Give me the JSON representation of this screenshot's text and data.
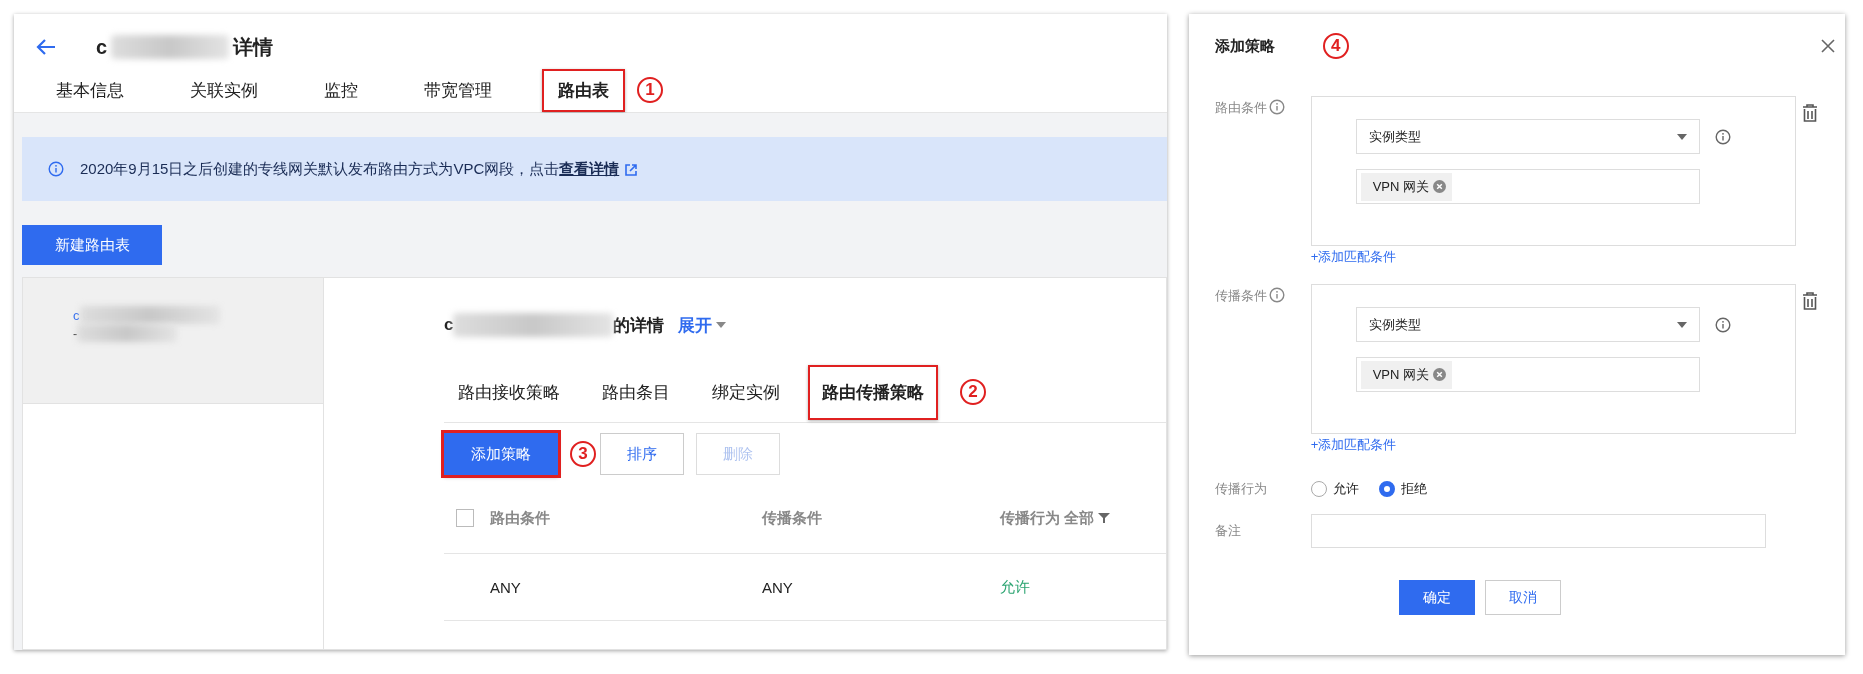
{
  "page": {
    "title_prefix": "c",
    "title_suffix": "详情",
    "tabs": [
      {
        "label": "基本信息",
        "selected": false,
        "highlighted": false
      },
      {
        "label": "关联实例",
        "selected": false,
        "highlighted": false
      },
      {
        "label": "监控",
        "selected": false,
        "highlighted": false
      },
      {
        "label": "带宽管理",
        "selected": false,
        "highlighted": false
      },
      {
        "label": "路由表",
        "selected": true,
        "highlighted": true
      }
    ],
    "tabs_marker": "1",
    "notice": {
      "text": "2020年9月15日之后创建的专线网关默认发布路由方式为VPC网段，点击",
      "link": "查看详情"
    },
    "create_button": "新建路由表",
    "route_tables": [
      {
        "name_prefix": "c",
        "line2": "-",
        "selected": true
      }
    ],
    "detail": {
      "title_prefix": "c",
      "title_suffix": "的详情",
      "expand": "展开",
      "tabs": [
        {
          "label": "路由接收策略",
          "selected": false,
          "highlighted": false
        },
        {
          "label": "路由条目",
          "selected": false,
          "highlighted": false
        },
        {
          "label": "绑定实例",
          "selected": false,
          "highlighted": false
        },
        {
          "label": "路由传播策略",
          "selected": true,
          "highlighted": true
        }
      ],
      "tabs_marker": "2",
      "buttons": [
        {
          "label": "添加策略",
          "kind": "primary",
          "disabled": false,
          "highlighted": true
        },
        {
          "label": "排序",
          "kind": "default",
          "disabled": false,
          "highlighted": false
        },
        {
          "label": "删除",
          "kind": "default",
          "disabled": true,
          "highlighted": false
        }
      ],
      "buttons_marker": "3",
      "table": {
        "select_all": {
          "checked": false
        },
        "columns": [
          "路由条件",
          "传播条件",
          "传播行为"
        ],
        "filter": "全部",
        "rows": [
          {
            "cells": [
              "ANY",
              "ANY",
              "允许"
            ],
            "color": "#2ba471"
          }
        ]
      }
    }
  },
  "dialog": {
    "title": "添加策略",
    "marker": "4",
    "groups": [
      {
        "label": "路由条件",
        "select": "实例类型",
        "tags": [
          "VPN 网关"
        ],
        "add_link": "+添加匹配条件"
      },
      {
        "label": "传播条件",
        "select": "实例类型",
        "tags": [
          "VPN 网关"
        ],
        "add_link": "+添加匹配条件"
      }
    ],
    "behavior": {
      "label": "传播行为",
      "options": [
        {
          "label": "允许",
          "selected": false
        },
        {
          "label": "拒绝",
          "selected": true
        }
      ]
    },
    "remark": {
      "label": "备注"
    },
    "buttons": [
      {
        "label": "确定",
        "kind": "primary"
      },
      {
        "label": "取消",
        "kind": "default"
      }
    ]
  }
}
